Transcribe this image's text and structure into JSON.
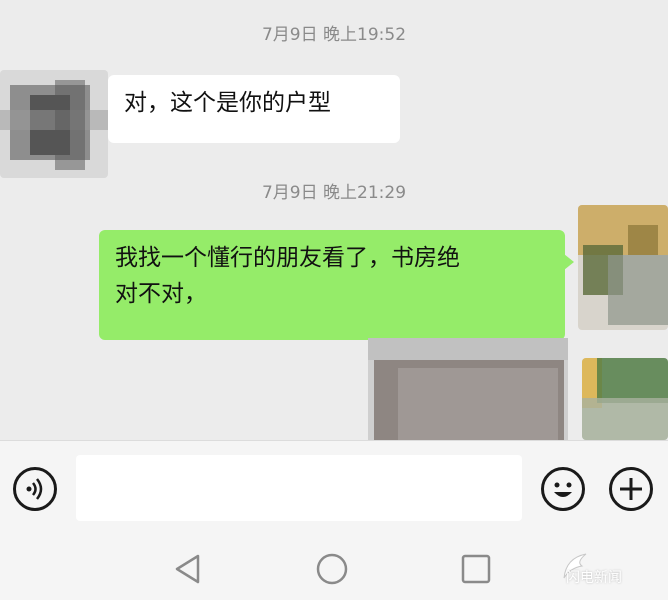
{
  "conversation": {
    "messages": [
      {
        "timestamp": "7月9日 晚上19:52",
        "direction": "incoming",
        "text": "对，这个是你的户型"
      },
      {
        "timestamp": "7月9日 晚上21:29",
        "direction": "outgoing",
        "text_line1": "我找一个懂行的朋友看了，书房绝",
        "text_line2": "对不对，",
        "has_image": true
      }
    ]
  },
  "input_bar": {
    "value": "",
    "placeholder": ""
  },
  "icons": {
    "voice": "voice-icon",
    "emoji": "emoji-icon",
    "plus": "plus-icon",
    "nav_back": "back-triangle-icon",
    "nav_home": "home-circle-icon",
    "nav_recent": "recent-square-icon"
  },
  "colors": {
    "chat_background": "#ececec",
    "incoming_bubble": "#ffffff",
    "outgoing_bubble": "#95ec69",
    "timestamp_text": "#8a8a8a"
  },
  "watermark": {
    "text": "闪电新闻"
  }
}
